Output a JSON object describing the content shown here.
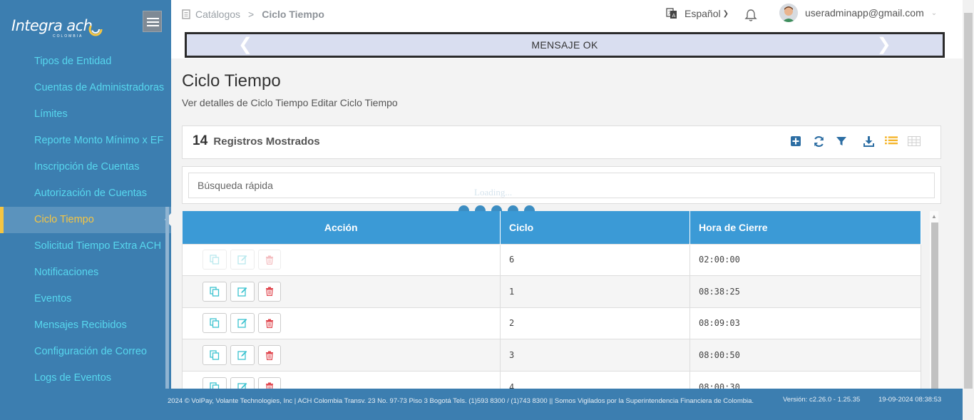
{
  "logo": {
    "text": "Integra ach",
    "subtitle": "COLOMBIA"
  },
  "sidebar": {
    "items": [
      {
        "label": "Tipos de Entidad"
      },
      {
        "label": "Cuentas de Administradoras"
      },
      {
        "label": "Límites"
      },
      {
        "label": "Reporte Monto Mínimo x EF"
      },
      {
        "label": "Inscripción de Cuentas"
      },
      {
        "label": "Autorización de Cuentas"
      },
      {
        "label": "Ciclo Tiempo"
      },
      {
        "label": "Solicitud Tiempo Extra ACH"
      },
      {
        "label": "Notificaciones"
      },
      {
        "label": "Eventos"
      },
      {
        "label": "Mensajes Recibidos"
      },
      {
        "label": "Configuración de Correo"
      },
      {
        "label": "Logs de Eventos"
      }
    ],
    "active_index": 6
  },
  "header": {
    "breadcrumb": {
      "parent": "Catálogos",
      "separator": ">",
      "current": "Ciclo Tiempo"
    },
    "language": "Español",
    "user_email": "useradminapp@gmail.com",
    "banner": "MENSAJE OK"
  },
  "main": {
    "title": "Ciclo Tiempo",
    "subtitle": "Ver detalles de Ciclo Tiempo Editar Ciclo Tiempo",
    "records_count": "14",
    "records_label": "Registros Mostrados",
    "search_placeholder": "Búsqueda rápida",
    "loading_text": "Loading..."
  },
  "table": {
    "headers": [
      "Acción",
      "Ciclo",
      "Hora de Cierre"
    ],
    "rows": [
      {
        "ciclo": "6",
        "hora": "02:00:00"
      },
      {
        "ciclo": "1",
        "hora": "08:38:25"
      },
      {
        "ciclo": "2",
        "hora": "08:09:03"
      },
      {
        "ciclo": "3",
        "hora": "08:00:50"
      },
      {
        "ciclo": "4",
        "hora": "08:00:30"
      }
    ]
  },
  "footer": {
    "text": "2024 © VolPay, Volante Technologies, Inc | ACH Colombia Transv. 23 No. 97-73 Piso 3 Bogotá Tels. (1)593 8300 / (1)743 8300 || Somos Vigilados por la Superintendencia Financiera de Colombia.",
    "version": "Versión: c2.26.0 - 1.25.35",
    "datetime": "19-09-2024 08:38:53"
  },
  "colors": {
    "sidebar_bg": "#3c7eb0",
    "sidebar_link": "#57d7ee",
    "active_accent": "#f5c542",
    "table_header": "#3b9ad6",
    "delete_red": "#e0434b",
    "action_teal": "#3cc3d0"
  },
  "icons": {
    "toolbar": [
      "plus-square-icon",
      "refresh-icon",
      "filter-icon",
      "download-icon",
      "list-view-icon",
      "grid-view-icon"
    ],
    "row_actions": [
      "copy-icon",
      "edit-icon",
      "trash-icon"
    ]
  }
}
